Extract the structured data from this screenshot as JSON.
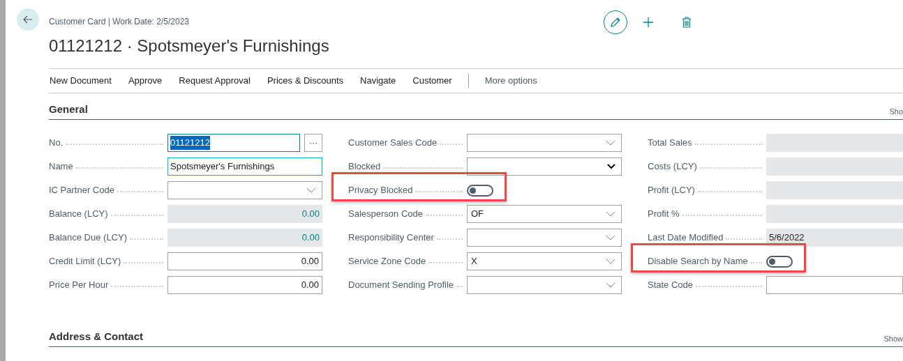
{
  "header": {
    "breadcrumb": "Customer Card | Work Date: 2/5/2023",
    "title": "01121212 · Spotsmeyer's Furnishings"
  },
  "actions": [
    {
      "label": "New Document"
    },
    {
      "label": "Approve"
    },
    {
      "label": "Request Approval"
    },
    {
      "label": "Prices & Discounts"
    },
    {
      "label": "Navigate"
    },
    {
      "label": "Customer"
    }
  ],
  "more_options": "More options",
  "general": {
    "title": "General",
    "show": "Sho",
    "columns": [
      [
        {
          "label": "No.",
          "kind": "lookup",
          "value": "01121212",
          "selected": true,
          "lookup": "···"
        },
        {
          "label": "Name",
          "kind": "text",
          "value": "Spotsmeyer's Furnishings",
          "focused": true
        },
        {
          "label": "IC Partner Code",
          "kind": "dropdown"
        },
        {
          "label": "Balance (LCY)",
          "kind": "flowfield",
          "value": "0.00"
        },
        {
          "label": "Balance Due (LCY)",
          "kind": "flowfield",
          "value": "0.00"
        },
        {
          "label": "Credit Limit (LCY)",
          "kind": "amount",
          "value": "0.00"
        },
        {
          "label": "Price Per Hour",
          "kind": "amount",
          "value": "0.00"
        }
      ],
      [
        {
          "label": "Customer Sales Code",
          "kind": "dropdown"
        },
        {
          "label": "Blocked",
          "kind": "select"
        },
        {
          "label": "Privacy Blocked",
          "kind": "toggle",
          "on": false,
          "highlighted": true
        },
        {
          "label": "Salesperson Code",
          "kind": "dropdown",
          "value": "OF"
        },
        {
          "label": "Responsibility Center",
          "kind": "dropdown"
        },
        {
          "label": "Service Zone Code",
          "kind": "dropdown",
          "value": "X"
        },
        {
          "label": "Document Sending Profile",
          "kind": "dropdown"
        }
      ],
      [
        {
          "label": "Total Sales",
          "kind": "readonly"
        },
        {
          "label": "Costs (LCY)",
          "kind": "readonly"
        },
        {
          "label": "Profit (LCY)",
          "kind": "readonly"
        },
        {
          "label": "Profit %",
          "kind": "readonly"
        },
        {
          "label": "Last Date Modified",
          "kind": "readonly",
          "value": "5/6/2022"
        },
        {
          "label": "Disable Search by Name",
          "kind": "toggle",
          "on": false,
          "highlighted": true
        },
        {
          "label": "State Code",
          "kind": "text"
        }
      ]
    ]
  },
  "address": {
    "title": "Address & Contact",
    "show": "Show"
  }
}
